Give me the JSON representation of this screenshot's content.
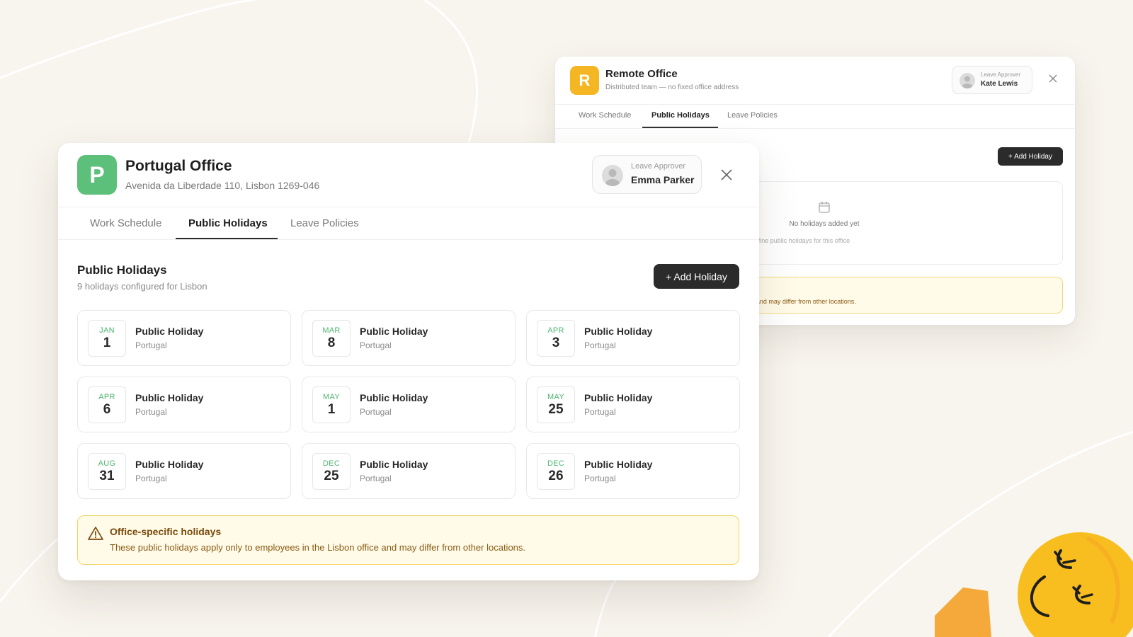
{
  "colors": {
    "background": "#f8f5ee",
    "portugal_logo": "#5cbf7a",
    "remote_logo": "#f5b624",
    "month_accent": "#4fb570",
    "notice_bg": "#fffbe8",
    "notice_border": "#f0d56a",
    "button_dark": "#2b2b2b"
  },
  "back_window": {
    "logo_letter": "R",
    "title": "Remote Office",
    "subtitle": "Distributed team — no fixed office address",
    "approver_label": "Leave Approver",
    "approver_name": "Kate Lewis",
    "tabs": [
      "Work Schedule",
      "Public Holidays",
      "Leave Policies"
    ],
    "active_tab": "Public Holidays",
    "add_button": "+ Add Holiday",
    "empty_title": "No holidays added yet",
    "empty_hint": "Holiday\" to define public holidays for this office",
    "notice_partial": "Lisbon office and may differ from other locations."
  },
  "front_window": {
    "logo_letter": "P",
    "title": "Portugal Office",
    "address": "Avenida da Liberdade 110, Lisbon 1269-046",
    "approver_label": "Leave Approver",
    "approver_name": "Emma Parker",
    "tabs": [
      "Work Schedule",
      "Public Holidays",
      "Leave Policies"
    ],
    "active_tab": "Public Holidays",
    "section_title": "Public Holidays",
    "section_subtitle": "9 holidays configured for Lisbon",
    "add_button": "+ Add Holiday",
    "holidays": [
      {
        "month": "JAN",
        "day": "1",
        "name": "Public Holiday",
        "country": "Portugal"
      },
      {
        "month": "MAR",
        "day": "8",
        "name": "Public Holiday",
        "country": "Portugal"
      },
      {
        "month": "APR",
        "day": "3",
        "name": "Public Holiday",
        "country": "Portugal"
      },
      {
        "month": "APR",
        "day": "6",
        "name": "Public Holiday",
        "country": "Portugal"
      },
      {
        "month": "MAY",
        "day": "1",
        "name": "Public Holiday",
        "country": "Portugal"
      },
      {
        "month": "MAY",
        "day": "25",
        "name": "Public Holiday",
        "country": "Portugal"
      },
      {
        "month": "AUG",
        "day": "31",
        "name": "Public Holiday",
        "country": "Portugal"
      },
      {
        "month": "DEC",
        "day": "25",
        "name": "Public Holiday",
        "country": "Portugal"
      },
      {
        "month": "DEC",
        "day": "26",
        "name": "Public Holiday",
        "country": "Portugal"
      }
    ],
    "notice_title": "Office-specific holidays",
    "notice_body": "These public holidays apply only to employees in the Lisbon office and may differ from other locations."
  },
  "icons": {
    "close": "close-icon",
    "warning": "warning-icon",
    "calendar": "calendar-icon",
    "avatar": "user-avatar-icon"
  }
}
